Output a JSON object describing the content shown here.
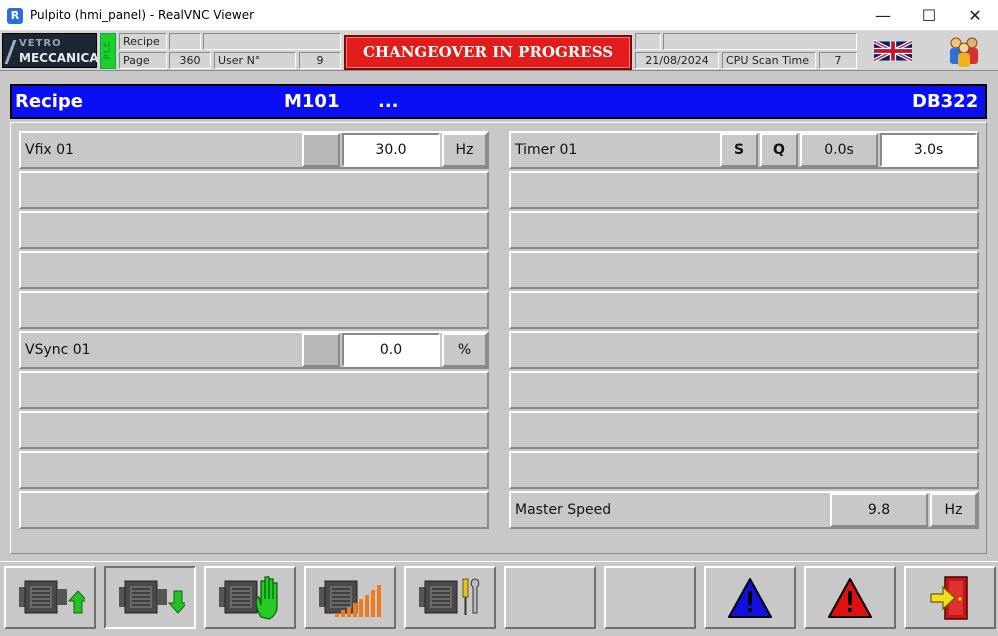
{
  "window": {
    "title": "Pulpito (hmi_panel) - RealVNC Viewer",
    "app_icon_text": "R"
  },
  "header": {
    "logo_line1": "VETRO",
    "logo_line2": "MECCANICA",
    "plc_label": "PLC",
    "recipe_label": "Recipe",
    "page_label": "Page",
    "page_value": "360",
    "user_label": "User N°",
    "user_value": "9",
    "banner": "CHANGEOVER IN PROGRESS",
    "date": "21/08/2024",
    "cpu_label": "CPU Scan Time",
    "cpu_value": "7"
  },
  "recipe_bar": {
    "label": "Recipe",
    "code": "M101",
    "name": "...",
    "db": "DB322"
  },
  "left_rows": [
    {
      "label": "Vfix 01",
      "value": "30.0",
      "unit": "Hz"
    },
    {
      "label": ""
    },
    {
      "label": ""
    },
    {
      "label": ""
    },
    {
      "label": ""
    },
    {
      "label": "VSync 01",
      "value": "0.0",
      "unit": "%"
    },
    {
      "label": ""
    },
    {
      "label": ""
    },
    {
      "label": ""
    },
    {
      "label": ""
    }
  ],
  "timer": {
    "label": "Timer 01",
    "s": "S",
    "q": "Q",
    "elapsed": "0.0s",
    "preset": "3.0s"
  },
  "master_speed": {
    "label": "Master Speed",
    "value": "9.8",
    "unit": "Hz"
  },
  "toolbar": {
    "buttons": [
      "motor-up",
      "motor-down",
      "motor-stop-hand",
      "motor-ramp",
      "motor-tools",
      "empty",
      "empty",
      "blue-warning",
      "red-warning",
      "exit-door"
    ]
  },
  "colors": {
    "recipe_bar": "#0a0ef5",
    "banner": "#e21b1b",
    "panel": "#c8c8c8"
  }
}
